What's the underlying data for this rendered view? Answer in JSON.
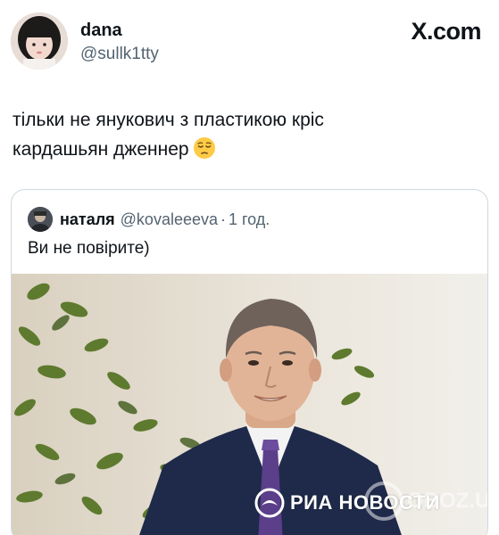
{
  "author": {
    "display_name": "dana",
    "handle": "@sullk1tty"
  },
  "site_logo": "X.com",
  "post": {
    "text_line1": "тільки не янукович з пластикою кріс",
    "text_line2": "кардашьян дженнер",
    "emoji": "pensive-face"
  },
  "quote": {
    "display_name": "наталя",
    "handle": "@kovaleeeva",
    "separator": "·",
    "time": "1 год.",
    "text": "Ви не повірите)"
  },
  "media": {
    "watermark_text": "РИА НОВОСТИ",
    "corner_watermark": "OBOZ.UA"
  },
  "colors": {
    "text_primary": "#0f1419",
    "text_secondary": "#536471",
    "border": "#cfd9de"
  }
}
